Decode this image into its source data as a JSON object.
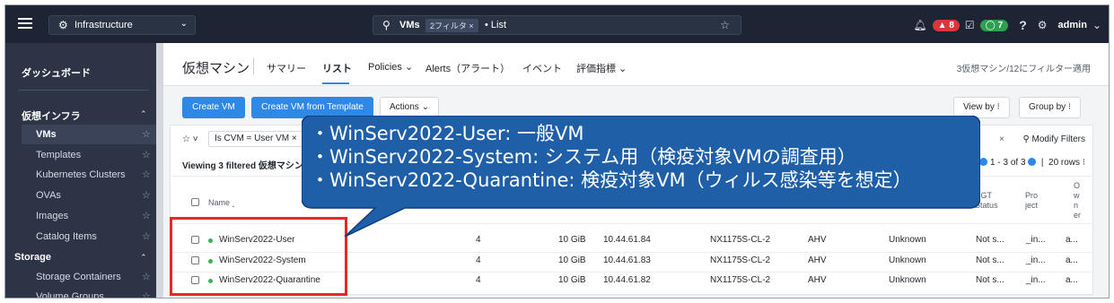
{
  "topbar": {
    "app_name": "Infrastructure",
    "search_entity": "VMs",
    "search_chip": "2フィルタ ×",
    "search_view": "• List",
    "alert_count": "8",
    "task_count": "7",
    "user": "admin"
  },
  "sidebar": {
    "dashboard": "ダッシュボード",
    "group1": "仮想インフラ",
    "items1": [
      {
        "label": "VMs"
      },
      {
        "label": "Templates"
      },
      {
        "label": "Kubernetes Clusters"
      },
      {
        "label": "OVAs"
      },
      {
        "label": "Images"
      },
      {
        "label": "Catalog Items"
      }
    ],
    "group2": "Storage",
    "items2": [
      {
        "label": "Storage Containers"
      },
      {
        "label": "Volume Groups"
      }
    ]
  },
  "header": {
    "title": "仮想マシン",
    "tabs": [
      {
        "label": "サマリー"
      },
      {
        "label": "リスト"
      },
      {
        "label": "Policies ⌄"
      },
      {
        "label": "Alerts（アラート）"
      },
      {
        "label": "イベント"
      },
      {
        "label": "評価指標 ⌄"
      }
    ],
    "filter_summary": "3仮想マシン/12にフィルター適用"
  },
  "toolbar": {
    "create_vm": "Create VM",
    "create_from_template": "Create VM from Template",
    "actions": "Actions ⌄",
    "view_by": "View by ⁝",
    "group_by": "Group by ⁝"
  },
  "filters": {
    "star": "☆ ˅",
    "chip": "Is CVM = User VM ×",
    "clear": "×",
    "modify": "⚲ Modify Filters",
    "viewing": "Viewing 3 filtered 仮想マシン",
    "pager_range": "1 - 3 of 3",
    "rows": "20 rows ⁝"
  },
  "table": {
    "headers": {
      "name": "Name ˬ",
      "ngt": "NGT Status",
      "project": "Pro ject",
      "owner": "O w n er"
    },
    "rows": [
      {
        "name": "WinServ2022-User",
        "vcpu": "4",
        "mem": "10 GiB",
        "ip": "10.44.61.84",
        "cluster": "NX1175S-CL-2",
        "hyp": "AHV",
        "state": "Unknown",
        "ngt": "Not s...",
        "project": "_in...",
        "owner": "a..."
      },
      {
        "name": "WinServ2022-System",
        "vcpu": "4",
        "mem": "10 GiB",
        "ip": "10.44.61.83",
        "cluster": "NX1175S-CL-2",
        "hyp": "AHV",
        "state": "Unknown",
        "ngt": "Not s...",
        "project": "_in...",
        "owner": "a..."
      },
      {
        "name": "WinServ2022-Quarantine",
        "vcpu": "4",
        "mem": "10 GiB",
        "ip": "10.44.61.82",
        "cluster": "NX1175S-CL-2",
        "hyp": "AHV",
        "state": "Unknown",
        "ngt": "Not s...",
        "project": "_in...",
        "owner": "a..."
      }
    ]
  },
  "callout": {
    "line1": "・WinServ2022-User:  一般VM",
    "line2": "・WinServ2022-System:  システム用（検疫対象VMの調査用）",
    "line3": "・WinServ2022-Quarantine:  検疫対象VM（ウィルス感染等を想定）"
  },
  "colors": {
    "topbar": "#1d2433",
    "sidebar": "#2c3445",
    "accent": "#2e89e6",
    "callout": "#1f5fa8",
    "highlight": "#e02b27"
  }
}
